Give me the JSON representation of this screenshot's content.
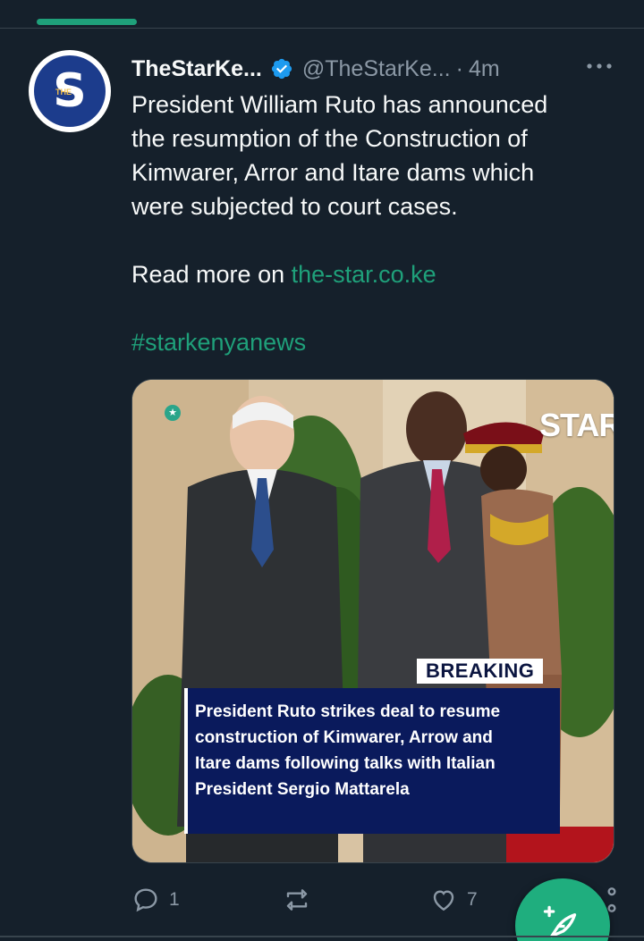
{
  "colors": {
    "accent": "#1fa07a",
    "background": "#15202b",
    "verified": "#1d9bf0",
    "fab": "#1fae7e"
  },
  "tweet": {
    "display_name": "TheStarKe...",
    "handle": "@TheStarKe...",
    "separator": "·",
    "time": "4m",
    "text_lines": [
      "President William Ruto has announced",
      "the resumption of the Construction of",
      "Kimwarer, Arror and Itare dams which",
      "were subjected to court cases."
    ],
    "read_more_prefix": "Read more on ",
    "link_text": "the-star.co.ke",
    "hashtag": "#starkenyanews"
  },
  "avatar": {
    "letter": "S",
    "small_text": "THE"
  },
  "media": {
    "brand": "STAR",
    "breaking": "BREAKING",
    "headline_lines": [
      "President Ruto strikes deal to resume",
      "construction of Kimwarer, Arrow and",
      "Itare dams following talks with Italian",
      "President Sergio Mattarela"
    ]
  },
  "actions": {
    "reply_count": "1",
    "like_count": "7"
  },
  "icons": {
    "verified": "verified-badge-icon",
    "more": "more-horizontal-icon",
    "reply": "reply-bubble-icon",
    "retweet": "retweet-icon",
    "like": "heart-icon",
    "share": "share-icon",
    "compose": "compose-feather-icon"
  }
}
